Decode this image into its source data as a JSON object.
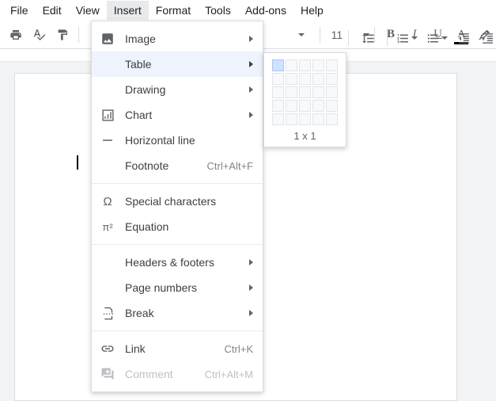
{
  "menubar": {
    "items": [
      "File",
      "Edit",
      "View",
      "Insert",
      "Format",
      "Tools",
      "Add-ons",
      "Help"
    ],
    "active_index": 3
  },
  "toolbar": {
    "font_size": "11"
  },
  "insert_menu": {
    "image": "Image",
    "table": "Table",
    "drawing": "Drawing",
    "chart": "Chart",
    "horizontal_line": "Horizontal line",
    "footnote": {
      "label": "Footnote",
      "shortcut": "Ctrl+Alt+F"
    },
    "special_chars": "Special characters",
    "equation": "Equation",
    "headers_footers": "Headers & footers",
    "page_numbers": "Page numbers",
    "break": "Break",
    "link": {
      "label": "Link",
      "shortcut": "Ctrl+K"
    },
    "comment": {
      "label": "Comment",
      "shortcut": "Ctrl+Alt+M"
    }
  },
  "table_picker": {
    "label": "1 x 1",
    "rows": 5,
    "cols": 5,
    "selected_rows": 1,
    "selected_cols": 1
  }
}
